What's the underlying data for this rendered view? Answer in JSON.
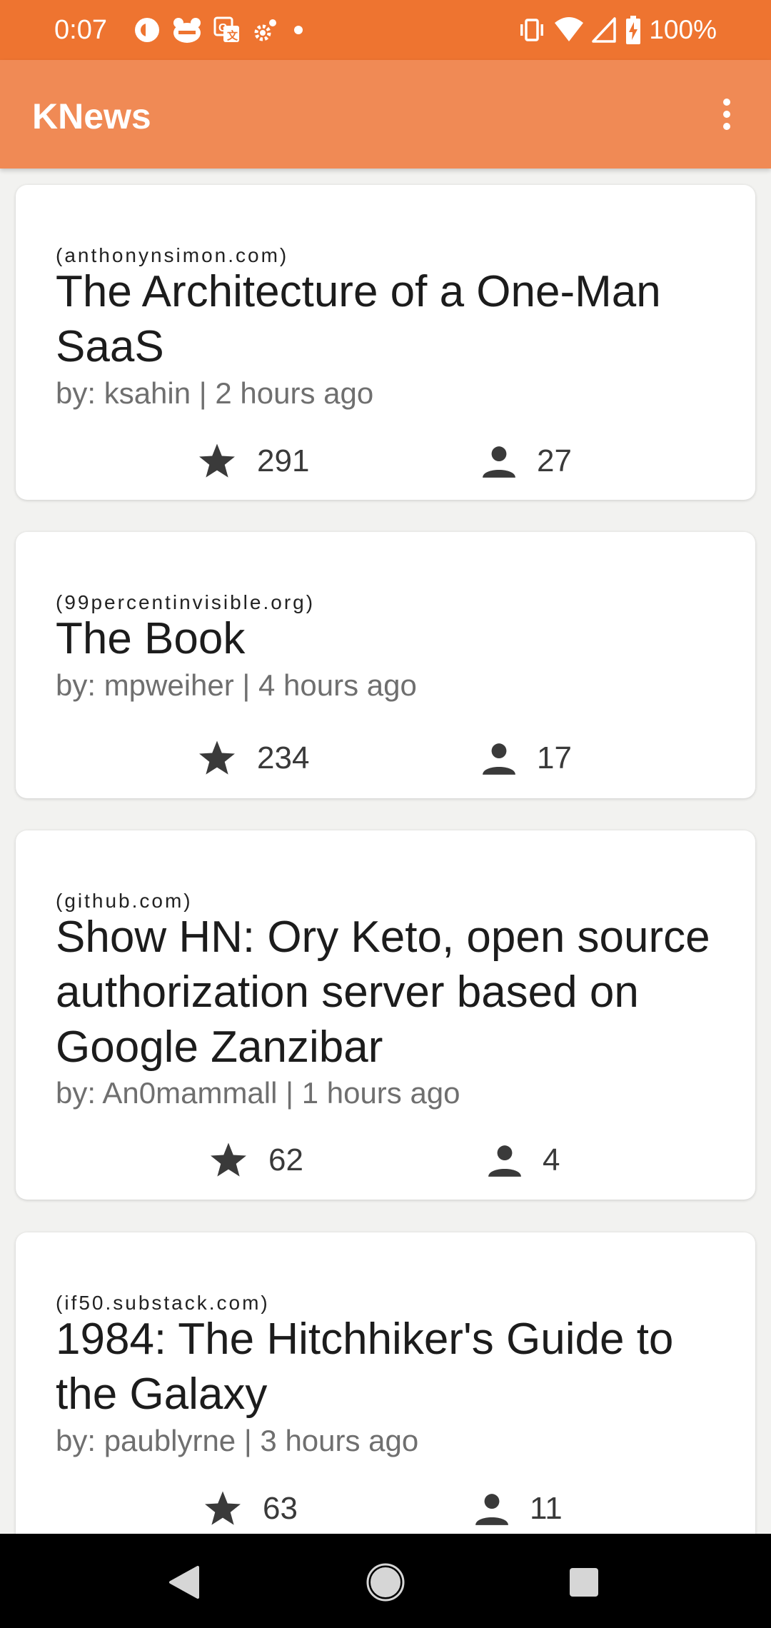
{
  "status_bar": {
    "time": "0:07",
    "battery": "100%",
    "left_icons": [
      "pocket-casts-icon",
      "app-notification-icon",
      "translate-icon",
      "settings-icon",
      "dot-icon"
    ],
    "right_icons": [
      "vibrate-icon",
      "wifi-icon",
      "signal-icon",
      "battery-charging-icon"
    ]
  },
  "app_bar": {
    "title": "KNews",
    "menu_icon": "more-vert-icon"
  },
  "stories": [
    {
      "source": "(anthonynsimon.com)",
      "title": "The Architecture of a One-Man SaaS",
      "meta": "by: ksahin | 2 hours ago",
      "points": "291",
      "comments": "27"
    },
    {
      "source": "(99percentinvisible.org)",
      "title": "The Book",
      "meta": "by: mpweiher | 4 hours ago",
      "points": "234",
      "comments": "17"
    },
    {
      "source": "(github.com)",
      "title": "Show HN: Ory Keto, open source authorization server based on Google Zanzibar",
      "meta": "by: An0mammall | 1 hours ago",
      "points": "62",
      "comments": "4"
    },
    {
      "source": "(if50.substack.com)",
      "title": "1984: The Hitchhiker's Guide to the Galaxy",
      "meta": "by: paublyrne | 3 hours ago",
      "points": "63",
      "comments": "11"
    }
  ],
  "nav_bar": {
    "buttons": [
      "back-icon",
      "home-icon",
      "recents-icon"
    ]
  },
  "colors": {
    "status_bar": "#ee7430",
    "app_bar": "#f08a55",
    "background": "#f2f2f0",
    "card": "#ffffff"
  }
}
